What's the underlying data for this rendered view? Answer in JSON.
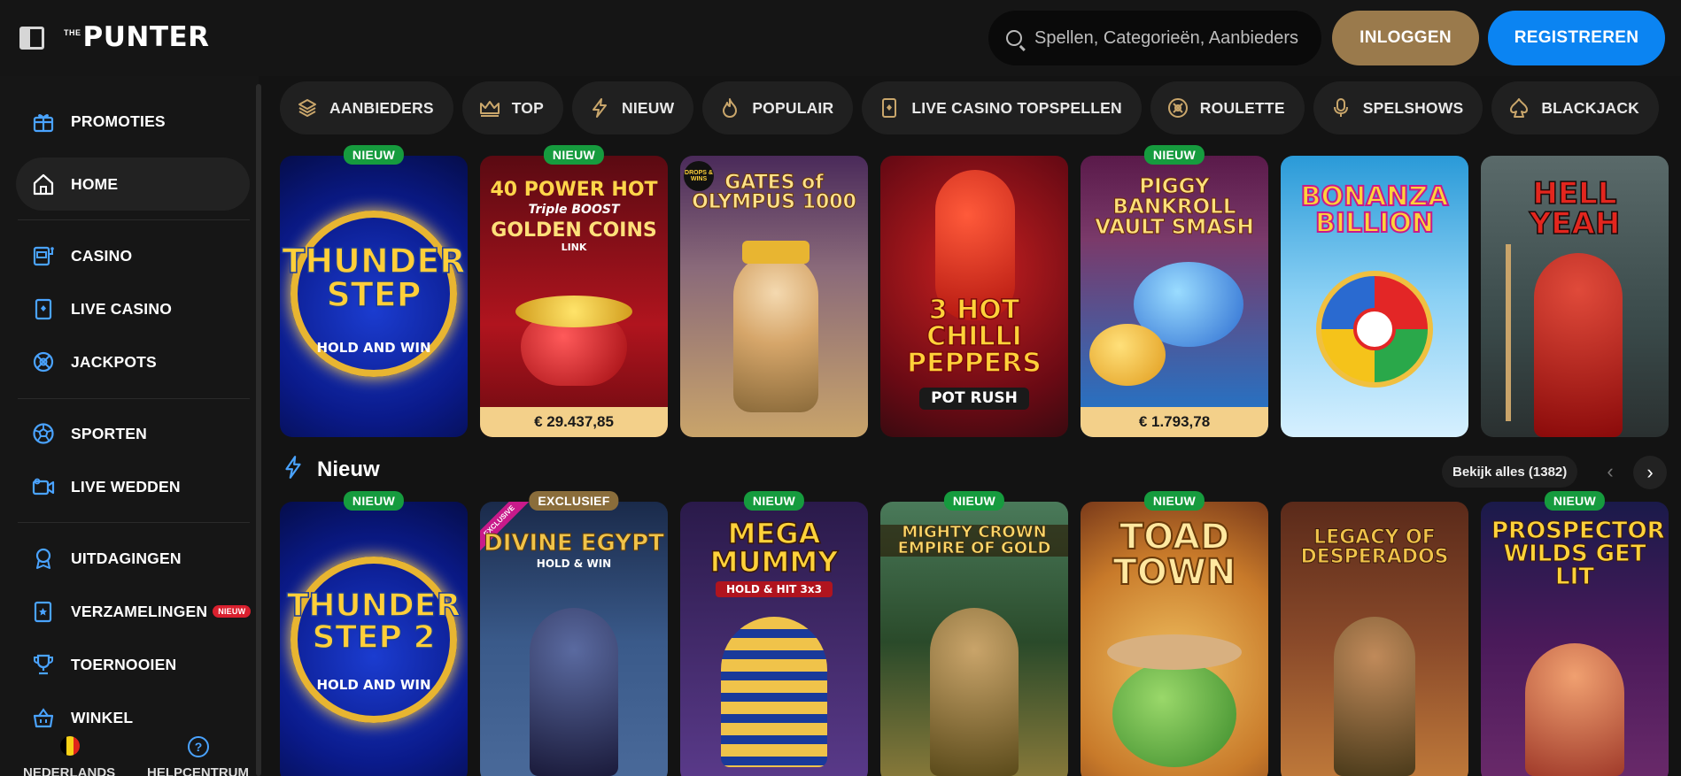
{
  "header": {
    "logo_small": "THE",
    "logo_main": "PUNTER",
    "search_placeholder": "Spellen, Categorieën, Aanbieders",
    "login_label": "INLOGGEN",
    "register_label": "REGISTREREN"
  },
  "sidebar": {
    "items": [
      {
        "label": "PROMOTIES",
        "icon": "gift-icon"
      },
      {
        "label": "HOME",
        "icon": "home-icon",
        "active": true
      },
      {
        "label": "CASINO",
        "icon": "slot-machine-icon"
      },
      {
        "label": "LIVE CASINO",
        "icon": "live-card-icon"
      },
      {
        "label": "JACKPOTS",
        "icon": "jackpot-icon"
      },
      {
        "label": "SPORTEN",
        "icon": "soccer-ball-icon"
      },
      {
        "label": "LIVE WEDDEN",
        "icon": "video-camera-icon"
      },
      {
        "label": "UITDAGINGEN",
        "icon": "ribbon-icon"
      },
      {
        "label": "VERZAMELINGEN",
        "icon": "collection-card-icon",
        "badge": "NIEUW"
      },
      {
        "label": "TOERNOOIEN",
        "icon": "trophy-icon"
      },
      {
        "label": "WINKEL",
        "icon": "basket-icon"
      }
    ],
    "footer": {
      "language_label": "NEDERLANDS",
      "help_label": "HELPCENTRUM",
      "help_glyph": "?"
    }
  },
  "chips": [
    {
      "label": "AANBIEDERS",
      "icon": "layers-icon"
    },
    {
      "label": "TOP",
      "icon": "crown-icon"
    },
    {
      "label": "NIEUW",
      "icon": "lightning-icon"
    },
    {
      "label": "POPULAIR",
      "icon": "flame-icon"
    },
    {
      "label": "LIVE CASINO TOPSPELLEN",
      "icon": "live-card-icon"
    },
    {
      "label": "ROULETTE",
      "icon": "roulette-icon"
    },
    {
      "label": "SPELSHOWS",
      "icon": "microphone-icon"
    },
    {
      "label": "BLACKJACK",
      "icon": "spade-icon"
    }
  ],
  "top_games": [
    {
      "title": "THUNDER STEP",
      "subtitle": "HOLD AND WIN",
      "badge": "NIEUW",
      "bg1": "#0a1a8a",
      "bg2": "#1b3cd0",
      "title_color": "#ffcf3a"
    },
    {
      "title": "40 POWER HOT",
      "subtitle": "GOLDEN COINS",
      "small": "Triple BOOST",
      "small2": "LINK",
      "badge": "NIEUW",
      "jackpot": "€ 29.437,85",
      "bg1": "#5a0a12",
      "bg2": "#b0141e",
      "title_color": "#ffd54a"
    },
    {
      "title": "GATES of OLYMPUS 1000",
      "corner": "DROPS & WINS",
      "bg1": "#4a2a5a",
      "bg2": "#c9a46a",
      "title_color": "#ffe28a"
    },
    {
      "title": "3 HOT CHILLI PEPPERS",
      "subtitle": "POT RUSH",
      "bg1": "#3a0a10",
      "bg2": "#c82020",
      "title_color": "#ffd23a"
    },
    {
      "title": "PIGGY BANKROLL VAULT SMASH",
      "badge": "NIEUW",
      "jackpot": "€ 1.793,78",
      "bg1": "#5a1a4a",
      "bg2": "#1a7ad0",
      "title_color": "#ffe07a"
    },
    {
      "title": "BONANZA BILLION",
      "bg1": "#2a9ad8",
      "bg2": "#d6f0ff",
      "title_color": "#ffd23a"
    },
    {
      "title": "HELL YEAH",
      "bg1": "#3a4a4a",
      "bg2": "#8a9a9a",
      "title_color": "#e3261e"
    }
  ],
  "section": {
    "title": "Nieuw",
    "see_all": "Bekijk alles (1382)",
    "prev": "‹",
    "next": "›"
  },
  "new_games": [
    {
      "title": "THUNDER STEP 2",
      "subtitle": "HOLD AND WIN",
      "badge": "NIEUW",
      "bg1": "#0a1a8a",
      "bg2": "#1b3cd0",
      "title_color": "#ffcf3a"
    },
    {
      "title": "DIVINE EGYPT",
      "subtitle": "HOLD & WIN",
      "badge": "EXCLUSIEF",
      "corner": "EXCLUSIVE",
      "bg1": "#1a2a4a",
      "bg2": "#4a6a9a",
      "title_color": "#f0c34a"
    },
    {
      "title": "MEGA MUMMY",
      "subtitle": "HOLD & HIT 3x3",
      "badge": "NIEUW",
      "bg1": "#2a1a4a",
      "bg2": "#5a3a8a",
      "title_color": "#ffd23a"
    },
    {
      "title": "MIGHTY CROWN EMPIRE OF GOLD",
      "badge": "NIEUW",
      "bg1": "#2a4a2a",
      "bg2": "#8a7a3a",
      "title_color": "#ffd76a"
    },
    {
      "title": "TOAD TOWN",
      "badge": "NIEUW",
      "bg1": "#c87a2a",
      "bg2": "#f0c060",
      "title_color": "#ffe8a0"
    },
    {
      "title": "LEGACY OF DESPERADOS",
      "bg1": "#5a2a1a",
      "bg2": "#c07a3a",
      "title_color": "#f0c34a"
    },
    {
      "title": "PROSPECTOR WILDS GET LIT",
      "badge": "NIEUW",
      "bg1": "#1a1a4a",
      "bg2": "#6a2a6a",
      "title_color": "#ffd23a"
    }
  ]
}
